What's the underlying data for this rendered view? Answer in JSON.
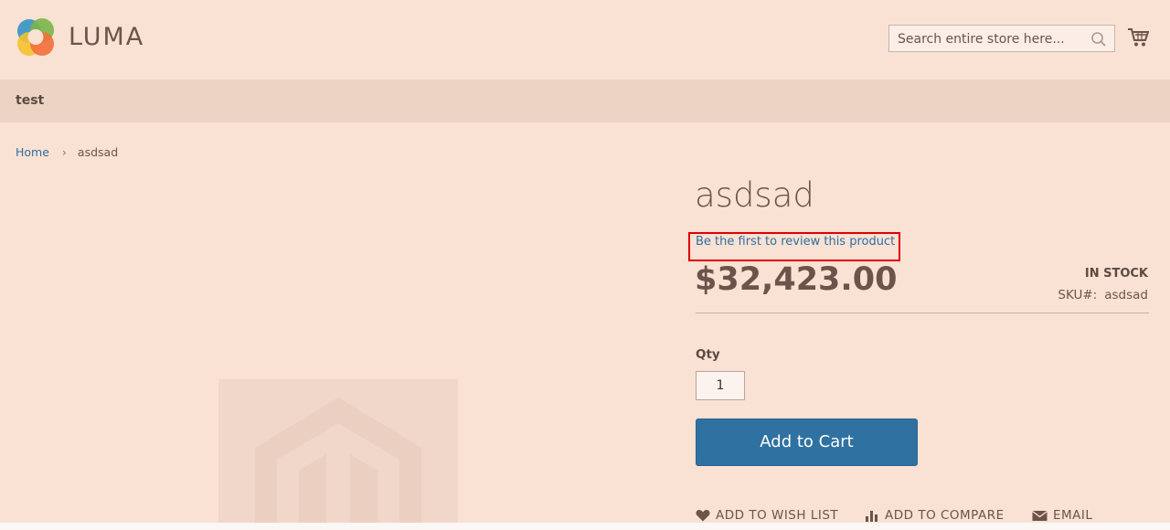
{
  "header": {
    "logo_text": "LUMA",
    "search_placeholder": "Search entire store here...",
    "logo_colors": [
      "#3f96c7",
      "#7ab648",
      "#f4c22f",
      "#f2703b"
    ]
  },
  "nav": {
    "items": [
      {
        "label": "test"
      }
    ]
  },
  "breadcrumb": {
    "home": "Home",
    "separator": "›",
    "current": "asdsad"
  },
  "product": {
    "name": "asdsad",
    "review_link": "Be the first to review this product",
    "price": "$32,423.00",
    "stock": "IN STOCK",
    "sku_label": "SKU#:",
    "sku_value": "asdsad",
    "qty_label": "Qty",
    "qty_value": "1",
    "add_to_cart": "Add to Cart"
  },
  "actions": {
    "wishlist": "ADD TO WISH LIST",
    "compare": "ADD TO COMPARE",
    "email": "EMAIL"
  },
  "colors": {
    "link": "#2e6fa0",
    "primary_button": "#2f71a1",
    "highlight_box": "#e00000"
  }
}
